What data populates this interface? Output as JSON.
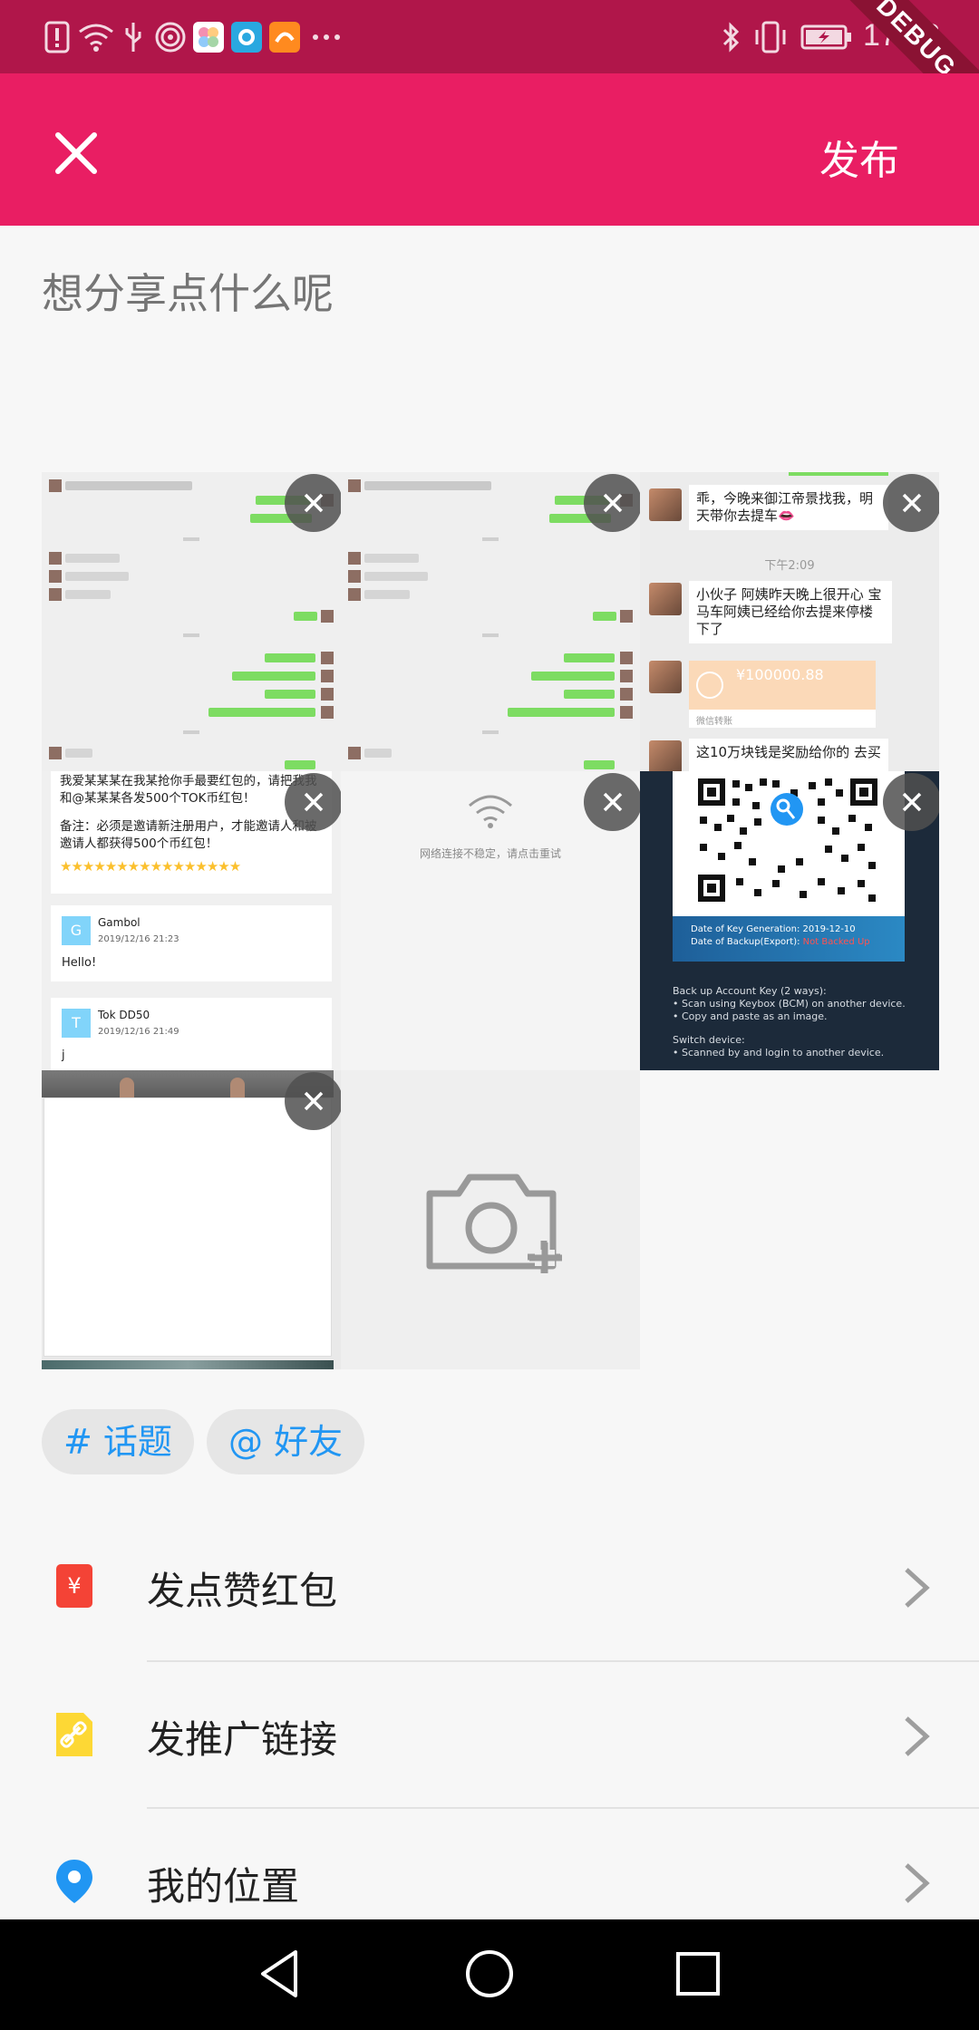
{
  "status_bar": {
    "time": "17:28",
    "debug_label": "DEBUG",
    "icons": [
      "alert-icon",
      "wifi-icon",
      "usb-icon",
      "hotspot-icon",
      "app-photos-icon",
      "app-qq-icon",
      "app-uc-icon",
      "more-icon",
      "bluetooth-icon",
      "vibrate-icon",
      "battery-icon"
    ]
  },
  "app_bar": {
    "publish_label": "发布"
  },
  "compose": {
    "placeholder": "想分享点什么呢"
  },
  "grid": {
    "chat2": {
      "msg1": "乖，今晚来御江帝景找我，明天带你去提车👄",
      "time": "下午2:09",
      "msg2": "小伙子 阿姨昨天晚上很开心 宝马车阿姨已经给你去提来停楼下了",
      "amount": "¥100000.88",
      "transfer_label": "微信转账",
      "msg3": "这10万块钱是奖励给你的 去买"
    },
    "envelope": {
      "text1": "我爱某某某在我某抢你手最要红包的，请把我我和@某某某各发500个TOK币红包！",
      "text2": "备注：必须是邀请新注册用户，才能邀请人和被邀请人都获得500个币红包！",
      "stars": "★★★★★★★★★★★★★★★★",
      "c1_initial": "G",
      "c1_name": "Gambol",
      "c1_time": "2019/12/16 21:23",
      "c1_text": "Hello!",
      "c2_initial": "T",
      "c2_name": "Tok DD50",
      "c2_time": "2019/12/16 21:49",
      "c2_text": "j"
    },
    "network": {
      "message": "网络连接不稳定，请点击重试"
    },
    "keybox": {
      "gen_date": "Date of Key Generation: 2019-12-10",
      "backup_label": "Date of Backup(Export): ",
      "backup_status": "Not Backed Up",
      "backup_title": "Back up Account Key (2 ways):",
      "backup_way1": "• Scan using Keybox (BCM) on another device.",
      "backup_way2": "• Copy and paste as an image.",
      "switch_title": "Switch device:",
      "switch_way1": "• Scanned by and login to another device."
    }
  },
  "tags": {
    "topic": "# 话题",
    "friend": "@ 好友"
  },
  "list": [
    {
      "label": "发点赞红包",
      "icon": "red-envelope-icon",
      "color": "#f44336"
    },
    {
      "label": "发推广链接",
      "icon": "link-document-icon",
      "color": "#fdd835"
    },
    {
      "label": "我的位置",
      "icon": "location-pin-icon",
      "color": "#2196f3"
    }
  ],
  "colors": {
    "status_bar": "#b0164a",
    "app_bar": "#e91e63",
    "accent_blue": "#2196f3"
  }
}
